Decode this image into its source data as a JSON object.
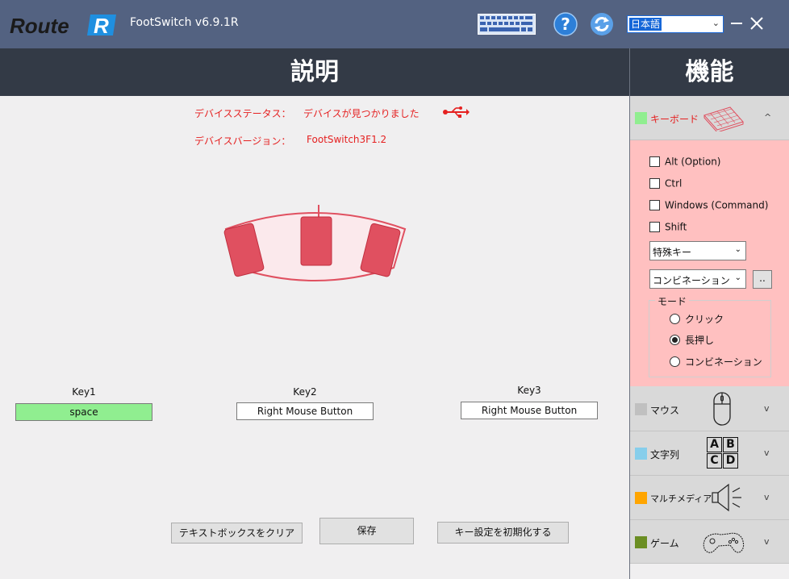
{
  "titlebar": {
    "logo_text": "Route R",
    "app_title": "FootSwitch v6.9.1R",
    "language": "日本語",
    "bg_color": "#536281"
  },
  "headers": {
    "description": "説明",
    "functions": "機能"
  },
  "device": {
    "status_label": "デバイスステータス：",
    "status_value": "デバイスが見つかりました",
    "version_label": "デバイスバージョン：",
    "version_value": "FootSwitch3F1.2",
    "pedal_color": "#e05060"
  },
  "keys": [
    {
      "label": "Key1",
      "value": "space",
      "color": "#90ee90"
    },
    {
      "label": "Key2",
      "value": "Right Mouse Button"
    },
    {
      "label": "Key3",
      "value": "Right Mouse Button"
    }
  ],
  "buttons": {
    "clear": "テキストボックスをクリア",
    "save": "保存",
    "reset": "キー設定を初期化する"
  },
  "sidebar": {
    "keyboard": {
      "title": "キーボード",
      "color": "#90ee90",
      "chevron": "^"
    },
    "keyboard_panel": {
      "modifiers": [
        "Alt (Option)",
        "Ctrl",
        "Windows (Command)",
        "Shift"
      ],
      "special_key": "特殊キー",
      "combination": "コンビネーション",
      "dots_button": "..",
      "mode_label": "モード",
      "modes": [
        "クリック",
        "長押し",
        "コンビネーション"
      ],
      "selected_mode": "長押し",
      "panel_color": "#ffc0c0"
    },
    "mouse": {
      "title": "マウス",
      "color": "#c0c0c0",
      "chevron": "v"
    },
    "text": {
      "title": "文字列",
      "color": "#87ceeb",
      "chevron": "v",
      "icon_letters": [
        "A",
        "B",
        "C",
        "D"
      ]
    },
    "multimedia": {
      "title": "マルチメディア",
      "color": "#ffa500",
      "chevron": "v"
    },
    "game": {
      "title": "ゲーム",
      "color": "#6b8e23",
      "chevron": "v"
    }
  }
}
